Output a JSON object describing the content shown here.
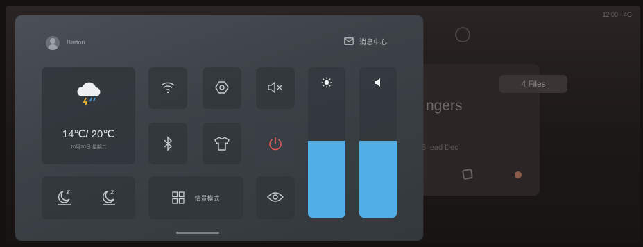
{
  "background_app": {
    "title_partial": "ngers",
    "badge_text": "4 Files",
    "subtitle_partial": "15 lead Dec",
    "time_text": "12:00 · 4G"
  },
  "control_center": {
    "user": {
      "name": "Barton"
    },
    "message_center": {
      "label": "消息中心",
      "icon": "mail-icon"
    },
    "weather": {
      "icon": "thunderstorm-cloud-icon",
      "temperature": "14℃/ 20℃",
      "detail": "10月20日 星期二"
    },
    "quick_toggles": [
      {
        "name": "wifi",
        "icon": "wifi-icon"
      },
      {
        "name": "settings",
        "icon": "hexagon-settings-icon"
      },
      {
        "name": "mute",
        "icon": "speaker-mute-icon"
      },
      {
        "name": "bluetooth",
        "icon": "bluetooth-icon"
      },
      {
        "name": "wardrobe",
        "icon": "shirt-icon"
      },
      {
        "name": "power",
        "icon": "power-icon"
      },
      {
        "name": "eye-care",
        "icon": "eye-icon"
      }
    ],
    "sleep_modes": [
      {
        "name": "sleep-mode-1",
        "icon": "moon-sleep-icon"
      },
      {
        "name": "sleep-mode-2",
        "icon": "moon-sleep-icon"
      }
    ],
    "scene": {
      "label": "情景模式",
      "icon": "grid-icon"
    },
    "sliders": [
      {
        "name": "brightness",
        "icon": "sun-icon",
        "level": 0.51
      },
      {
        "name": "volume",
        "icon": "speaker-icon",
        "level": 0.51
      }
    ],
    "accent_color": "#52aee6"
  }
}
